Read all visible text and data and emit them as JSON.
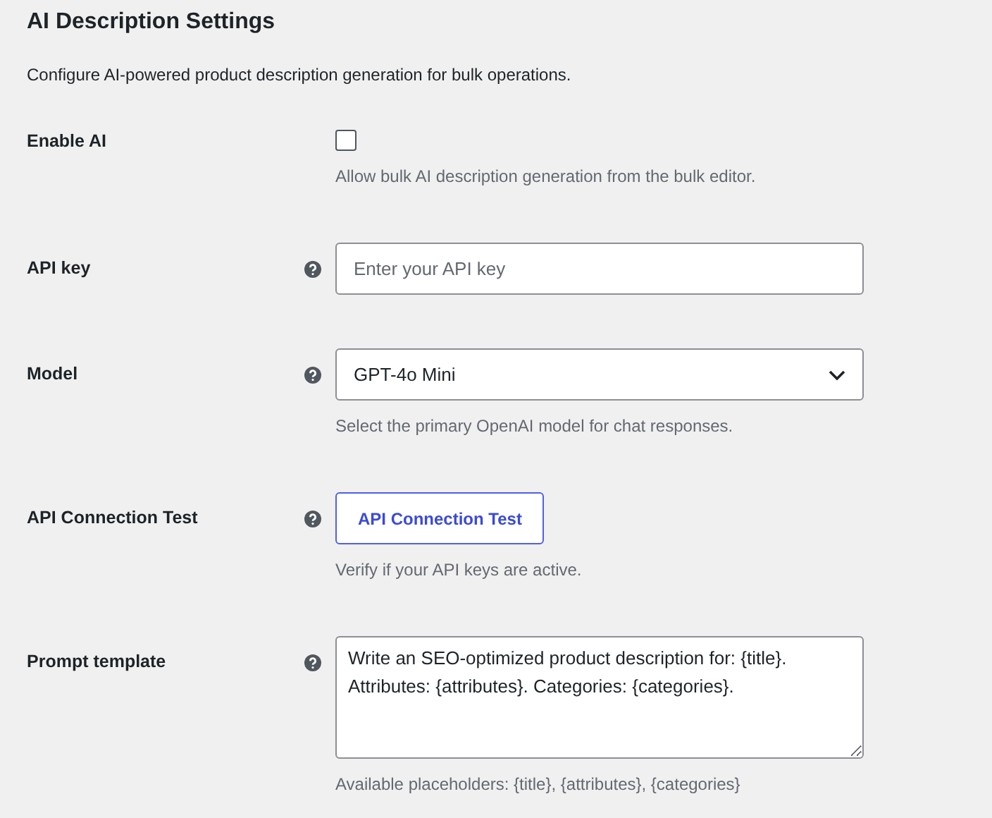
{
  "title": "AI Description Settings",
  "description": "Configure AI-powered product description generation for bulk operations.",
  "fields": [
    {
      "kind": "checkbox",
      "label": "Enable AI",
      "help": false,
      "checked": false,
      "hint": "Allow bulk AI description generation from the bulk editor."
    },
    {
      "kind": "text",
      "label": "API key",
      "help": true,
      "placeholder": "Enter your API key"
    },
    {
      "kind": "select",
      "label": "Model",
      "help": true,
      "value": "GPT-4o Mini",
      "hint": "Select the primary OpenAI model for chat responses."
    },
    {
      "kind": "button",
      "label": "API Connection Test",
      "help": true,
      "button": "API Connection Test",
      "hint": "Verify if your API keys are active."
    },
    {
      "kind": "textarea",
      "label": "Prompt template",
      "help": true,
      "value": "Write an SEO-optimized product description for: {title}.\nAttributes: {attributes}. Categories: {categories}.",
      "hint": "Available placeholders: {title}, {attributes}, {categories}"
    }
  ]
}
